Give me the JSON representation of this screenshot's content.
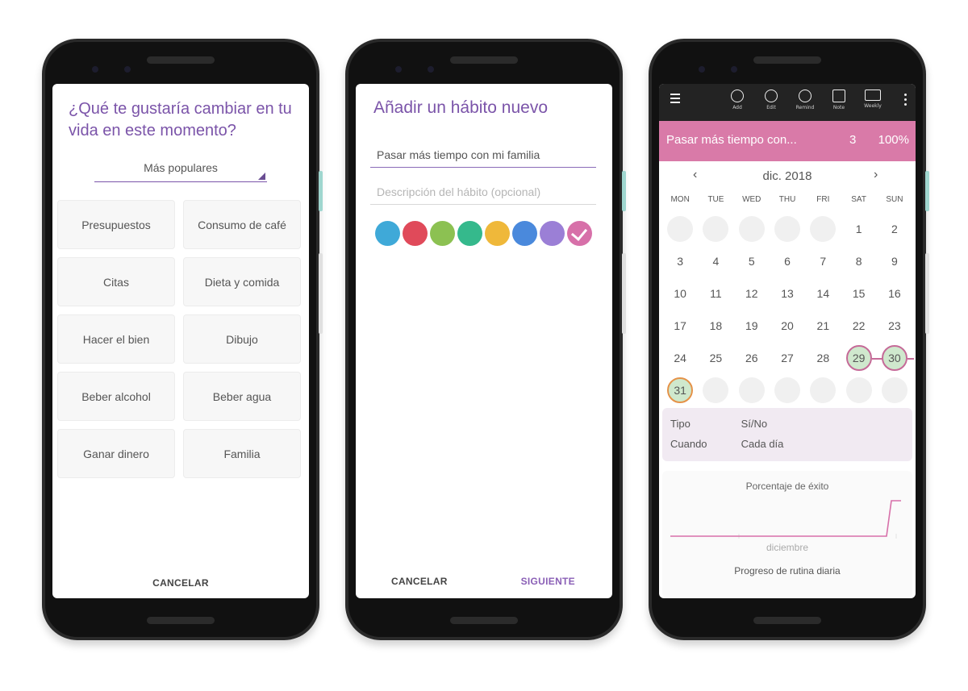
{
  "screen1": {
    "title": "¿Qué te gustaría cambiar en tu vida en este momento?",
    "dropdown_selected": "Más populares",
    "categories": [
      "Presupuestos",
      "Consumo de café",
      "Citas",
      "Dieta y comida",
      "Hacer el bien",
      "Dibujo",
      "Beber alcohol",
      "Beber agua",
      "Ganar dinero",
      "Familia"
    ],
    "cancel_label": "CANCELAR"
  },
  "screen2": {
    "title": "Añadir un hábito nuevo",
    "name_value": "Pasar más tiempo con mi familia",
    "description_placeholder": "Descripción del hábito (opcional)",
    "colors": [
      "#3fa9d8",
      "#e04a5a",
      "#8cc152",
      "#35b98c",
      "#efb83a",
      "#4a89dc",
      "#9b7fd6",
      "#d770a9"
    ],
    "selected_color_index": 7,
    "cancel_label": "CANCELAR",
    "next_label": "SIGUIENTE"
  },
  "screen3": {
    "toolbar": [
      {
        "label": "Add",
        "icon": "add-icon"
      },
      {
        "label": "Edit",
        "icon": "gear-icon"
      },
      {
        "label": "Remind",
        "icon": "alarm-icon"
      },
      {
        "label": "Note",
        "icon": "note-icon"
      },
      {
        "label": "Weekly",
        "icon": "calendar-icon"
      }
    ],
    "habit": {
      "name": "Pasar más tiempo con...",
      "count": "3",
      "percent": "100%"
    },
    "month_label": "dic. 2018",
    "weekdays": [
      "MON",
      "TUE",
      "WED",
      "THU",
      "FRI",
      "SAT",
      "SUN"
    ],
    "leading_empty": 5,
    "days_in_month": 31,
    "completed_days": [
      29,
      30
    ],
    "today": 31,
    "trailing_empty": 6,
    "info": {
      "type_label": "Tipo",
      "type_value": "Sí/No",
      "when_label": "Cuando",
      "when_value": "Cada día"
    },
    "chart_title": "Porcentaje de éxito",
    "chart_xlabel": "diciembre",
    "footer_label": "Progreso de rutina diaria"
  }
}
